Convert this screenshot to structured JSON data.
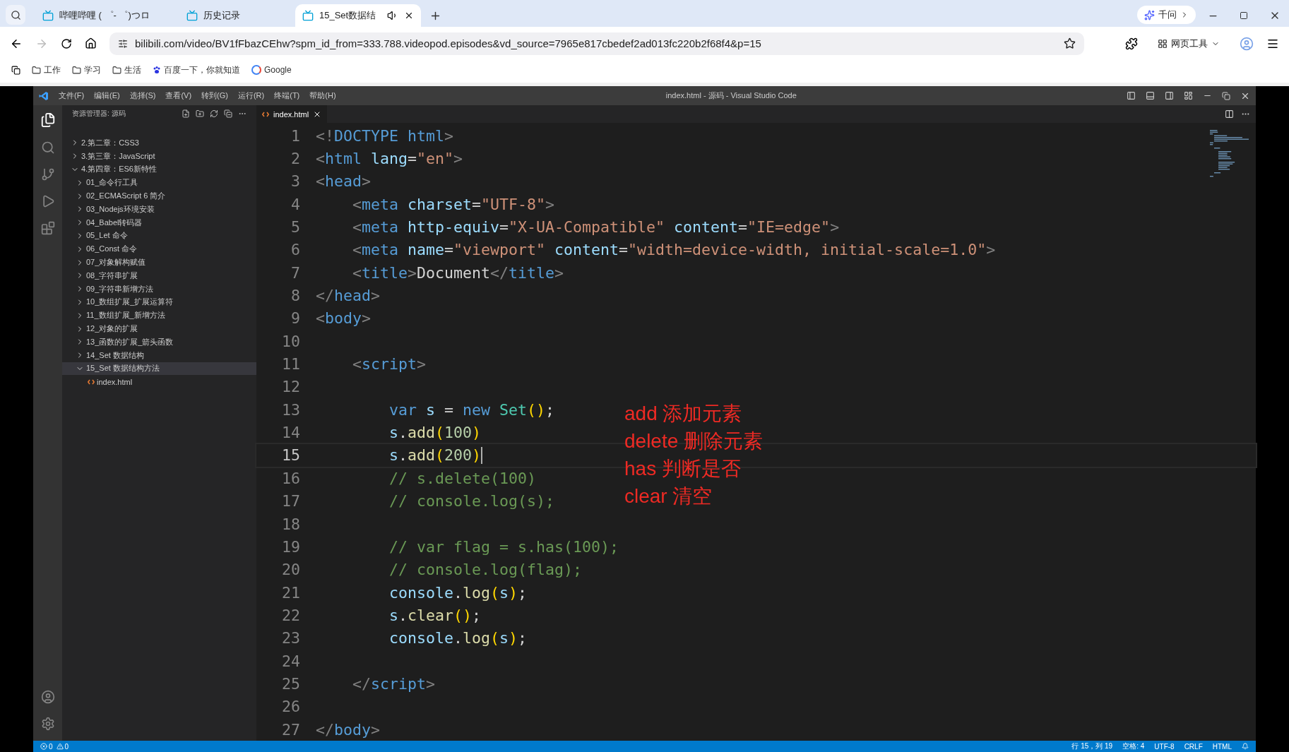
{
  "browser": {
    "tabs": [
      {
        "label": "哔哩哔哩 ( ゜- ゜)つロ",
        "selected": false,
        "audio": false
      },
      {
        "label": "历史记录",
        "selected": false,
        "audio": false
      },
      {
        "label": "15_Set数据结",
        "selected": true,
        "audio": true
      }
    ],
    "assistant": "千问",
    "url": "bilibili.com/video/BV1fFbazCEhw?spm_id_from=333.788.videopod.episodes&vd_source=7965e817cbedef2ad013fc220b2f68f4&p=15",
    "tools": "网页工具",
    "bookmarks": [
      {
        "label": "工作",
        "kind": "folder"
      },
      {
        "label": "学习",
        "kind": "folder"
      },
      {
        "label": "生活",
        "kind": "folder"
      },
      {
        "label": "百度一下，你就知道",
        "kind": "baidu"
      },
      {
        "label": "Google",
        "kind": "google"
      }
    ]
  },
  "vscode": {
    "menu": [
      "文件(F)",
      "编辑(E)",
      "选择(S)",
      "查看(V)",
      "转到(G)",
      "运行(R)",
      "终端(T)",
      "帮助(H)"
    ],
    "title": "index.html - 源码 - Visual Studio Code",
    "explorer": {
      "header": "资源管理器: 源码",
      "tree": [
        {
          "label": "2.第二章：CSS3",
          "expanded": false,
          "selected": false
        },
        {
          "label": "3.第三章：JavaScript",
          "expanded": false,
          "selected": false
        },
        {
          "label": "4.第四章：ES6新特性",
          "expanded": true,
          "selected": false,
          "children": [
            {
              "label": "01_命令行工具",
              "expanded": false,
              "selected": false
            },
            {
              "label": "02_ECMAScript 6 简介",
              "expanded": false,
              "selected": false
            },
            {
              "label": "03_Nodejs环境安装",
              "expanded": false,
              "selected": false
            },
            {
              "label": "04_Babel转码器",
              "expanded": false,
              "selected": false
            },
            {
              "label": "05_Let 命令",
              "expanded": false,
              "selected": false
            },
            {
              "label": "06_Const 命令",
              "expanded": false,
              "selected": false
            },
            {
              "label": "07_对象解构赋值",
              "expanded": false,
              "selected": false
            },
            {
              "label": "08_字符串扩展",
              "expanded": false,
              "selected": false
            },
            {
              "label": "09_字符串新增方法",
              "expanded": false,
              "selected": false
            },
            {
              "label": "10_数组扩展_扩展运算符",
              "expanded": false,
              "selected": false
            },
            {
              "label": "11_数组扩展_新增方法",
              "expanded": false,
              "selected": false
            },
            {
              "label": "12_对象的扩展",
              "expanded": false,
              "selected": false
            },
            {
              "label": "13_函数的扩展_箭头函数",
              "expanded": false,
              "selected": false
            },
            {
              "label": "14_Set 数据结构",
              "expanded": false,
              "selected": false
            },
            {
              "label": "15_Set 数据结构方法",
              "expanded": true,
              "selected": true,
              "children": [
                {
                  "label": "index.html",
                  "kind": "file",
                  "selected": false
                }
              ]
            }
          ]
        }
      ]
    },
    "editor_tab": "index.html",
    "lines": [
      {
        "num": "1",
        "current": false,
        "tokens": [
          {
            "text": "<!",
            "kind": "bracket"
          },
          {
            "text": "DOCTYPE",
            "kind": "tag"
          },
          {
            "text": " html",
            "kind": "tag"
          },
          {
            "text": ">",
            "kind": "bracket"
          }
        ]
      },
      {
        "num": "2",
        "current": false,
        "tokens": [
          {
            "text": "<",
            "kind": "bracket"
          },
          {
            "text": "html",
            "kind": "tag"
          },
          {
            "text": " lang",
            "kind": "attr"
          },
          {
            "text": "=",
            "kind": "plain"
          },
          {
            "text": "\"en\"",
            "kind": "string"
          },
          {
            "text": ">",
            "kind": "bracket"
          }
        ]
      },
      {
        "num": "3",
        "current": false,
        "tokens": [
          {
            "text": "<",
            "kind": "bracket"
          },
          {
            "text": "head",
            "kind": "tag"
          },
          {
            "text": ">",
            "kind": "bracket"
          }
        ]
      },
      {
        "num": "4",
        "current": false,
        "tokens": [
          {
            "text": "    <",
            "kind": "bracket"
          },
          {
            "text": "meta",
            "kind": "tag"
          },
          {
            "text": " charset",
            "kind": "attr"
          },
          {
            "text": "=",
            "kind": "plain"
          },
          {
            "text": "\"UTF-8\"",
            "kind": "string"
          },
          {
            "text": ">",
            "kind": "bracket"
          }
        ]
      },
      {
        "num": "5",
        "current": false,
        "tokens": [
          {
            "text": "    <",
            "kind": "bracket"
          },
          {
            "text": "meta",
            "kind": "tag"
          },
          {
            "text": " http-equiv",
            "kind": "attr"
          },
          {
            "text": "=",
            "kind": "plain"
          },
          {
            "text": "\"X-UA-Compatible\"",
            "kind": "string"
          },
          {
            "text": " content",
            "kind": "attr"
          },
          {
            "text": "=",
            "kind": "plain"
          },
          {
            "text": "\"IE=edge\"",
            "kind": "string"
          },
          {
            "text": ">",
            "kind": "bracket"
          }
        ]
      },
      {
        "num": "6",
        "current": false,
        "tokens": [
          {
            "text": "    <",
            "kind": "bracket"
          },
          {
            "text": "meta",
            "kind": "tag"
          },
          {
            "text": " name",
            "kind": "attr"
          },
          {
            "text": "=",
            "kind": "plain"
          },
          {
            "text": "\"viewport\"",
            "kind": "string"
          },
          {
            "text": " content",
            "kind": "attr"
          },
          {
            "text": "=",
            "kind": "plain"
          },
          {
            "text": "\"width=device-width, initial-scale=1.0\"",
            "kind": "string"
          },
          {
            "text": ">",
            "kind": "bracket"
          }
        ]
      },
      {
        "num": "7",
        "current": false,
        "tokens": [
          {
            "text": "    <",
            "kind": "bracket"
          },
          {
            "text": "title",
            "kind": "tag"
          },
          {
            "text": ">",
            "kind": "bracket"
          },
          {
            "text": "Document",
            "kind": "plain"
          },
          {
            "text": "</",
            "kind": "bracket"
          },
          {
            "text": "title",
            "kind": "tag"
          },
          {
            "text": ">",
            "kind": "bracket"
          }
        ]
      },
      {
        "num": "8",
        "current": false,
        "tokens": [
          {
            "text": "</",
            "kind": "bracket"
          },
          {
            "text": "head",
            "kind": "tag"
          },
          {
            "text": ">",
            "kind": "bracket"
          }
        ]
      },
      {
        "num": "9",
        "current": false,
        "tokens": [
          {
            "text": "<",
            "kind": "bracket"
          },
          {
            "text": "body",
            "kind": "tag"
          },
          {
            "text": ">",
            "kind": "bracket"
          }
        ]
      },
      {
        "num": "10",
        "current": false
      },
      {
        "num": "11",
        "current": false,
        "tokens": [
          {
            "text": "    <",
            "kind": "bracket"
          },
          {
            "text": "script",
            "kind": "tag"
          },
          {
            "text": ">",
            "kind": "bracket"
          }
        ]
      },
      {
        "num": "12",
        "current": false
      },
      {
        "num": "13",
        "current": false,
        "tokens": [
          {
            "text": "        var",
            "kind": "keyword"
          },
          {
            "text": " s",
            "kind": "variable"
          },
          {
            "text": " = ",
            "kind": "plain"
          },
          {
            "text": "new",
            "kind": "keyword"
          },
          {
            "text": " Set",
            "kind": "class"
          },
          {
            "text": "()",
            "kind": "paren"
          },
          {
            "text": ";",
            "kind": "plain"
          }
        ]
      },
      {
        "num": "14",
        "current": false,
        "tokens": [
          {
            "text": "        s",
            "kind": "variable"
          },
          {
            "text": ".",
            "kind": "plain"
          },
          {
            "text": "add",
            "kind": "function"
          },
          {
            "text": "(",
            "kind": "paren"
          },
          {
            "text": "100",
            "kind": "number"
          },
          {
            "text": ")",
            "kind": "paren"
          }
        ]
      },
      {
        "num": "15",
        "current": true,
        "tokens": [
          {
            "text": "        s",
            "kind": "variable"
          },
          {
            "text": ".",
            "kind": "plain"
          },
          {
            "text": "add",
            "kind": "function"
          },
          {
            "text": "(",
            "kind": "paren"
          },
          {
            "text": "200",
            "kind": "number"
          },
          {
            "text": ")",
            "kind": "paren"
          }
        ]
      },
      {
        "num": "16",
        "current": false,
        "tokens": [
          {
            "text": "        // s.delete(100)",
            "kind": "comment"
          }
        ]
      },
      {
        "num": "17",
        "current": false,
        "tokens": [
          {
            "text": "        // console.log(s);",
            "kind": "comment"
          }
        ]
      },
      {
        "num": "18",
        "current": false
      },
      {
        "num": "19",
        "current": false,
        "tokens": [
          {
            "text": "        // var flag = s.has(100);",
            "kind": "comment"
          }
        ]
      },
      {
        "num": "20",
        "current": false,
        "tokens": [
          {
            "text": "        // console.log(flag);",
            "kind": "comment"
          }
        ]
      },
      {
        "num": "21",
        "current": false,
        "tokens": [
          {
            "text": "        console",
            "kind": "variable"
          },
          {
            "text": ".",
            "kind": "plain"
          },
          {
            "text": "log",
            "kind": "function"
          },
          {
            "text": "(",
            "kind": "paren"
          },
          {
            "text": "s",
            "kind": "variable"
          },
          {
            "text": ")",
            "kind": "paren"
          },
          {
            "text": ";",
            "kind": "plain"
          }
        ]
      },
      {
        "num": "22",
        "current": false,
        "tokens": [
          {
            "text": "        s",
            "kind": "variable"
          },
          {
            "text": ".",
            "kind": "plain"
          },
          {
            "text": "clear",
            "kind": "function"
          },
          {
            "text": "()",
            "kind": "paren"
          },
          {
            "text": ";",
            "kind": "plain"
          }
        ]
      },
      {
        "num": "23",
        "current": false,
        "tokens": [
          {
            "text": "        console",
            "kind": "variable"
          },
          {
            "text": ".",
            "kind": "plain"
          },
          {
            "text": "log",
            "kind": "function"
          },
          {
            "text": "(",
            "kind": "paren"
          },
          {
            "text": "s",
            "kind": "variable"
          },
          {
            "text": ")",
            "kind": "paren"
          },
          {
            "text": ";",
            "kind": "plain"
          }
        ]
      },
      {
        "num": "24",
        "current": false
      },
      {
        "num": "25",
        "current": false,
        "tokens": [
          {
            "text": "    </",
            "kind": "bracket"
          },
          {
            "text": "script",
            "kind": "tag"
          },
          {
            "text": ">",
            "kind": "bracket"
          }
        ]
      },
      {
        "num": "26",
        "current": false
      },
      {
        "num": "27",
        "current": false,
        "tokens": [
          {
            "text": "</",
            "kind": "bracket"
          },
          {
            "text": "body",
            "kind": "tag"
          },
          {
            "text": ">",
            "kind": "bracket"
          }
        ]
      }
    ],
    "annotation": [
      "add 添加元素",
      "delete 删除元素",
      "has 判断是否",
      "clear 清空"
    ],
    "status": {
      "errors": "0",
      "warnings": "0",
      "right": [
        "行 15，列 19",
        "空格: 4",
        "UTF-8",
        "CRLF",
        "HTML"
      ]
    }
  }
}
